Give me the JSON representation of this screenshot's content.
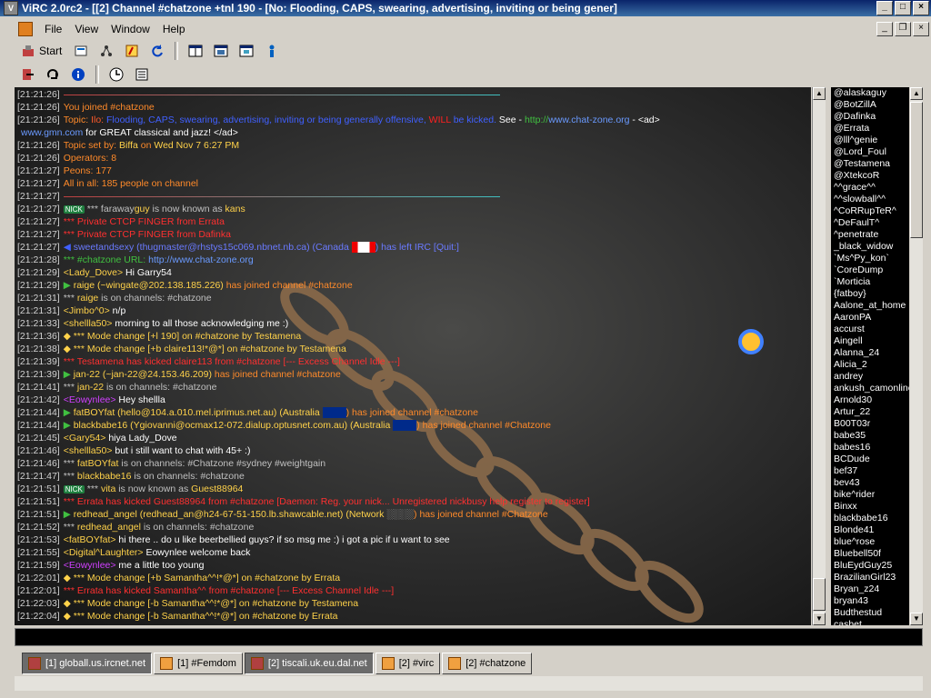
{
  "window": {
    "title": "ViRC 2.0rc2 - [[2] Channel #chatzone +tnl 190 - [No: Flooding, CAPS, swearing, advertising, inviting or being gener]"
  },
  "menu": [
    "File",
    "View",
    "Window",
    "Help"
  ],
  "toolbar": {
    "start_label": "Start"
  },
  "chat": [
    {
      "t": "[21:21:26]",
      "c": [
        {
          "x": "",
          "c": "#fff"
        }
      ],
      "rule": true
    },
    {
      "t": "[21:21:26]",
      "c": [
        {
          "x": "You joined #chatzone",
          "c": "#ff8a2a"
        }
      ]
    },
    {
      "t": "[21:21:26]",
      "c": [
        {
          "x": "Topic:",
          "c": "#ff8a2a"
        },
        {
          "x": "              Ilo: ",
          "c": "#ff5a2a"
        },
        {
          "x": "Flooding, CAPS, swearing, advertising, inviting or being generally offensive, ",
          "c": "#4060ff"
        },
        {
          "x": "WILL",
          "c": "#ff2020"
        },
        {
          "x": " be kicked.  ",
          "c": "#4060ff"
        },
        {
          "x": "See - ",
          "c": "#fff"
        },
        {
          "x": "http://",
          "c": "#40c040"
        },
        {
          "x": "www.chat-zone.org",
          "c": "#6a9aff"
        },
        {
          "x": " - <ad>",
          "c": "#fff"
        }
      ]
    },
    {
      "t": "",
      "c": [
        {
          "x": "www.gmn.com",
          "c": "#6a9aff"
        },
        {
          "x": " for GREAT classical and jazz! </ad>",
          "c": "#fff"
        }
      ]
    },
    {
      "t": "[21:21:26]",
      "c": [
        {
          "x": "Topic set by:",
          "c": "#ff8a2a"
        },
        {
          "x": "        Biffa",
          "c": "#ffd24a"
        },
        {
          "x": " on ",
          "c": "#ff8a2a"
        },
        {
          "x": "Wed Nov 7 6:27 PM",
          "c": "#ffd24a"
        }
      ]
    },
    {
      "t": "[21:21:26]",
      "c": [
        {
          "x": "Operators:",
          "c": "#ff8a2a"
        },
        {
          "x": "            8",
          "c": "#ff8a2a"
        }
      ]
    },
    {
      "t": "[21:21:27]",
      "c": [
        {
          "x": "Peons:",
          "c": "#ff8a2a"
        },
        {
          "x": "                 177",
          "c": "#ff8a2a"
        }
      ]
    },
    {
      "t": "[21:21:27]",
      "c": [
        {
          "x": "All in all:",
          "c": "#ff8a2a"
        },
        {
          "x": "            185 people on channel",
          "c": "#ff8a2a"
        }
      ]
    },
    {
      "t": "[21:21:27]",
      "c": [
        {
          "x": "",
          "c": "#fff"
        }
      ],
      "rule": true
    },
    {
      "t": "[21:21:27]",
      "c": [
        {
          "x": "NICK",
          "c": "#fff",
          "badge": true
        },
        {
          "x": " *** faraway",
          "c": "#c0c0c0"
        },
        {
          "x": "guy",
          "c": "#ffd24a"
        },
        {
          "x": " is now known as ",
          "c": "#c0c0c0"
        },
        {
          "x": "kans",
          "c": "#ffd24a"
        }
      ]
    },
    {
      "t": "[21:21:27]",
      "c": [
        {
          "x": "*** Private CTCP FINGER from ",
          "c": "#ff3030"
        },
        {
          "x": "Errata",
          "c": "#ff3030"
        }
      ]
    },
    {
      "t": "[21:21:27]",
      "c": [
        {
          "x": "*** Private CTCP FINGER from ",
          "c": "#ff3030"
        },
        {
          "x": "Dafinka",
          "c": "#ff3030"
        }
      ]
    },
    {
      "t": "[21:21:27]",
      "c": [
        {
          "x": "◀  ",
          "c": "#4060ff"
        },
        {
          "x": "sweetandsexy (thugmaster@rhstys15c069.nbnet.nb.ca) (Canada ",
          "c": "#6a7aff"
        },
        {
          "x": "🇨🇦",
          "c": "#fff",
          "flag": "ca"
        },
        {
          "x": ") has left IRC [Quit:]",
          "c": "#6a7aff"
        }
      ]
    },
    {
      "t": "[21:21:28]",
      "c": [
        {
          "x": "*** #chatzone URL: ",
          "c": "#40c040"
        },
        {
          "x": "http://www.chat-zone.org",
          "c": "#6a9aff"
        }
      ]
    },
    {
      "t": "[21:21:29]",
      "c": [
        {
          "x": "<Lady_Dove>",
          "c": "#ffd24a"
        },
        {
          "x": "         Hi Garry54",
          "c": "#fff"
        }
      ]
    },
    {
      "t": "[21:21:29]",
      "c": [
        {
          "x": "▶  ",
          "c": "#40c040"
        },
        {
          "x": "raige (~wingate@202.138.185.226)",
          "c": "#ffd24a"
        },
        {
          "x": " has joined channel #chatzone",
          "c": "#ff8a2a"
        }
      ]
    },
    {
      "t": "[21:21:31]",
      "c": [
        {
          "x": "*** ",
          "c": "#c0c0c0"
        },
        {
          "x": "raige",
          "c": "#ffd24a"
        },
        {
          "x": " is on channels: #chatzone",
          "c": "#c0c0c0"
        }
      ]
    },
    {
      "t": "[21:21:31]",
      "c": [
        {
          "x": "<Jimbo^0>",
          "c": "#ffd24a"
        },
        {
          "x": "             n/p",
          "c": "#fff"
        }
      ]
    },
    {
      "t": "[21:21:33]",
      "c": [
        {
          "x": "<shellla50>",
          "c": "#ffd24a"
        },
        {
          "x": "          morning to all those acknowledging me :)",
          "c": "#fff"
        }
      ]
    },
    {
      "t": "[21:21:36]",
      "c": [
        {
          "x": "◆  *** Mode change [+l 190] on #chatzone by ",
          "c": "#ffd24a"
        },
        {
          "x": "Testamena",
          "c": "#ffd24a"
        }
      ]
    },
    {
      "t": "[21:21:38]",
      "c": [
        {
          "x": "◆  *** Mode change [+b claire113!*@*] on #chatzone by ",
          "c": "#ffd24a"
        },
        {
          "x": "Testamena",
          "c": "#ffd24a"
        }
      ]
    },
    {
      "t": "[21:21:39]",
      "c": [
        {
          "x": "*** Testamena has kicked claire113 from #chatzone [--- Excess Channel Idle ---]",
          "c": "#ff3030"
        }
      ]
    },
    {
      "t": "[21:21:39]",
      "c": [
        {
          "x": "▶  ",
          "c": "#40c040"
        },
        {
          "x": "jan-22 (~jan-22@24.153.46.209)",
          "c": "#ffd24a"
        },
        {
          "x": " has joined channel #chatzone",
          "c": "#ff8a2a"
        }
      ]
    },
    {
      "t": "[21:21:41]",
      "c": [
        {
          "x": "*** ",
          "c": "#c0c0c0"
        },
        {
          "x": "jan-22",
          "c": "#ffd24a"
        },
        {
          "x": " is on channels: #chatzone",
          "c": "#c0c0c0"
        }
      ]
    },
    {
      "t": "[21:21:42]",
      "c": [
        {
          "x": "<Eowynlee>",
          "c": "#d040ff"
        },
        {
          "x": "          Hey shellla",
          "c": "#fff"
        }
      ]
    },
    {
      "t": "[21:21:44]",
      "c": [
        {
          "x": "▶  ",
          "c": "#40c040"
        },
        {
          "x": "fatBOYfat (hello@104.a.010.mel.iprimus.net.au) (Australia ",
          "c": "#ffd24a"
        },
        {
          "x": "🇦🇺",
          "c": "#fff",
          "flag": "au"
        },
        {
          "x": ") has joined channel #chatzone",
          "c": "#ff8a2a"
        }
      ]
    },
    {
      "t": "[21:21:44]",
      "c": [
        {
          "x": "▶  ",
          "c": "#40c040"
        },
        {
          "x": "blackbabe16 (Ygiovanni@ocmax12-072.dialup.optusnet.com.au) (Australia ",
          "c": "#ffd24a"
        },
        {
          "x": "🇦🇺",
          "c": "#fff",
          "flag": "au"
        },
        {
          "x": ") has joined channel #Chatzone",
          "c": "#ff8a2a"
        }
      ]
    },
    {
      "t": "[21:21:45]",
      "c": [
        {
          "x": "<Gary54>",
          "c": "#ffd24a"
        },
        {
          "x": "               hiya Lady_Dove",
          "c": "#fff"
        }
      ]
    },
    {
      "t": "[21:21:46]",
      "c": [
        {
          "x": "<shellla50>",
          "c": "#ffd24a"
        },
        {
          "x": "          but i still want to chat with 45+ :)",
          "c": "#fff"
        }
      ]
    },
    {
      "t": "[21:21:46]",
      "c": [
        {
          "x": "*** ",
          "c": "#c0c0c0"
        },
        {
          "x": "fatBOYfat",
          "c": "#ffd24a"
        },
        {
          "x": " is on channels: #Chatzone #sydney #weightgain",
          "c": "#c0c0c0"
        }
      ]
    },
    {
      "t": "[21:21:47]",
      "c": [
        {
          "x": "*** ",
          "c": "#c0c0c0"
        },
        {
          "x": "blackbabe16",
          "c": "#ffd24a"
        },
        {
          "x": " is on channels: #chatzone",
          "c": "#c0c0c0"
        }
      ]
    },
    {
      "t": "[21:21:51]",
      "c": [
        {
          "x": "NICK",
          "c": "#fff",
          "badge": true
        },
        {
          "x": " *** ",
          "c": "#c0c0c0"
        },
        {
          "x": "vita",
          "c": "#ffd24a"
        },
        {
          "x": " is now known as ",
          "c": "#c0c0c0"
        },
        {
          "x": "Guest88964",
          "c": "#ffd24a"
        }
      ]
    },
    {
      "t": "[21:21:51]",
      "c": [
        {
          "x": "*** Errata has kicked Guest88964 from #chatzone [Daemon: Reg. your nick... Unregistered nickbusy help register to register]",
          "c": "#ff3030"
        }
      ]
    },
    {
      "t": "[21:21:51]",
      "c": [
        {
          "x": "▶  ",
          "c": "#40c040"
        },
        {
          "x": "redhead_angel (redhead_an@h24-67-51-150.lb.shawcable.net) (Network ",
          "c": "#ffd24a"
        },
        {
          "x": "░░░░",
          "c": "#aaa"
        },
        {
          "x": ") has joined channel #Chatzone",
          "c": "#ff8a2a"
        }
      ]
    },
    {
      "t": "[21:21:52]",
      "c": [
        {
          "x": "*** ",
          "c": "#c0c0c0"
        },
        {
          "x": "redhead_angel",
          "c": "#ffd24a"
        },
        {
          "x": " is on channels: #chatzone",
          "c": "#c0c0c0"
        }
      ]
    },
    {
      "t": "[21:21:53]",
      "c": [
        {
          "x": "<fatBOYfat>",
          "c": "#ffd24a"
        },
        {
          "x": "          hi there .. do u like beerbellied guys? if so msg me :) i got a pic if u want to see",
          "c": "#fff"
        }
      ]
    },
    {
      "t": "[21:21:55]",
      "c": [
        {
          "x": "<Digital^Laughter>",
          "c": "#ffd24a"
        },
        {
          "x": "  Eowynlee welcome back",
          "c": "#fff"
        }
      ]
    },
    {
      "t": "[21:21:59]",
      "c": [
        {
          "x": "<Eowynlee>",
          "c": "#d040ff"
        },
        {
          "x": "          me a little too young",
          "c": "#fff"
        }
      ]
    },
    {
      "t": "[21:22:01]",
      "c": [
        {
          "x": "◆  *** Mode change [+b Samantha^^!*@*] on #chatzone by ",
          "c": "#ffd24a"
        },
        {
          "x": "Errata",
          "c": "#ffd24a"
        }
      ]
    },
    {
      "t": "[21:22:01]",
      "c": [
        {
          "x": "*** Errata has kicked Samantha^^ from #chatzone [--- Excess Channel Idle ---]",
          "c": "#ff3030"
        }
      ]
    },
    {
      "t": "[21:22:03]",
      "c": [
        {
          "x": "◆  *** Mode change [-b Samantha^^!*@*] on #chatzone by ",
          "c": "#ffd24a"
        },
        {
          "x": "Testamena",
          "c": "#ffd24a"
        }
      ]
    },
    {
      "t": "[21:22:04]",
      "c": [
        {
          "x": "◆  *** Mode change [-b Samantha^^!*@*] on #chatzone by ",
          "c": "#ffd24a"
        },
        {
          "x": "Errata",
          "c": "#ffd24a"
        }
      ]
    }
  ],
  "users": [
    "@alaskaguy",
    "@BotZillA",
    "@Dafinka",
    "@Errata",
    "@lll^genie",
    "@Lord_Foul",
    "@Testamena",
    "@XtekcoR",
    "^^grace^^",
    "^^slowball^^",
    "^CoRRupTeR^",
    "^DeFaulT^",
    "^penetrate",
    "_black_widow",
    "`Ms^Py_kon`",
    "`CoreDump",
    "`Morticia",
    "{fatboy}",
    "Aalone_at_home",
    "AaronPA",
    "accurst",
    "Aingell",
    "Alanna_24",
    "Alicia_2",
    "andrey",
    "ankush_camonline",
    "Arnold30",
    "Artur_22",
    "B00T03r",
    "babe35",
    "babes16",
    "BCDude",
    "bef37",
    "bev43",
    "bike^rider",
    "Binxx",
    "blackbabe16",
    "Blonde41",
    "blue^rose",
    "Bluebell50f",
    "BluEydGuy25",
    "BrazilianGirl23",
    "Bryan_z24",
    "bryan43",
    "Budthestud",
    "cashet"
  ],
  "tabs": [
    {
      "label": "[1] globall.us.ircnet.net",
      "active": true
    },
    {
      "label": "[1] #Femdom",
      "active": false
    },
    {
      "label": "[2] tiscali.uk.eu.dal.net",
      "active": true
    },
    {
      "label": "[2] #virc",
      "active": false
    },
    {
      "label": "[2] #chatzone",
      "active": false
    }
  ]
}
